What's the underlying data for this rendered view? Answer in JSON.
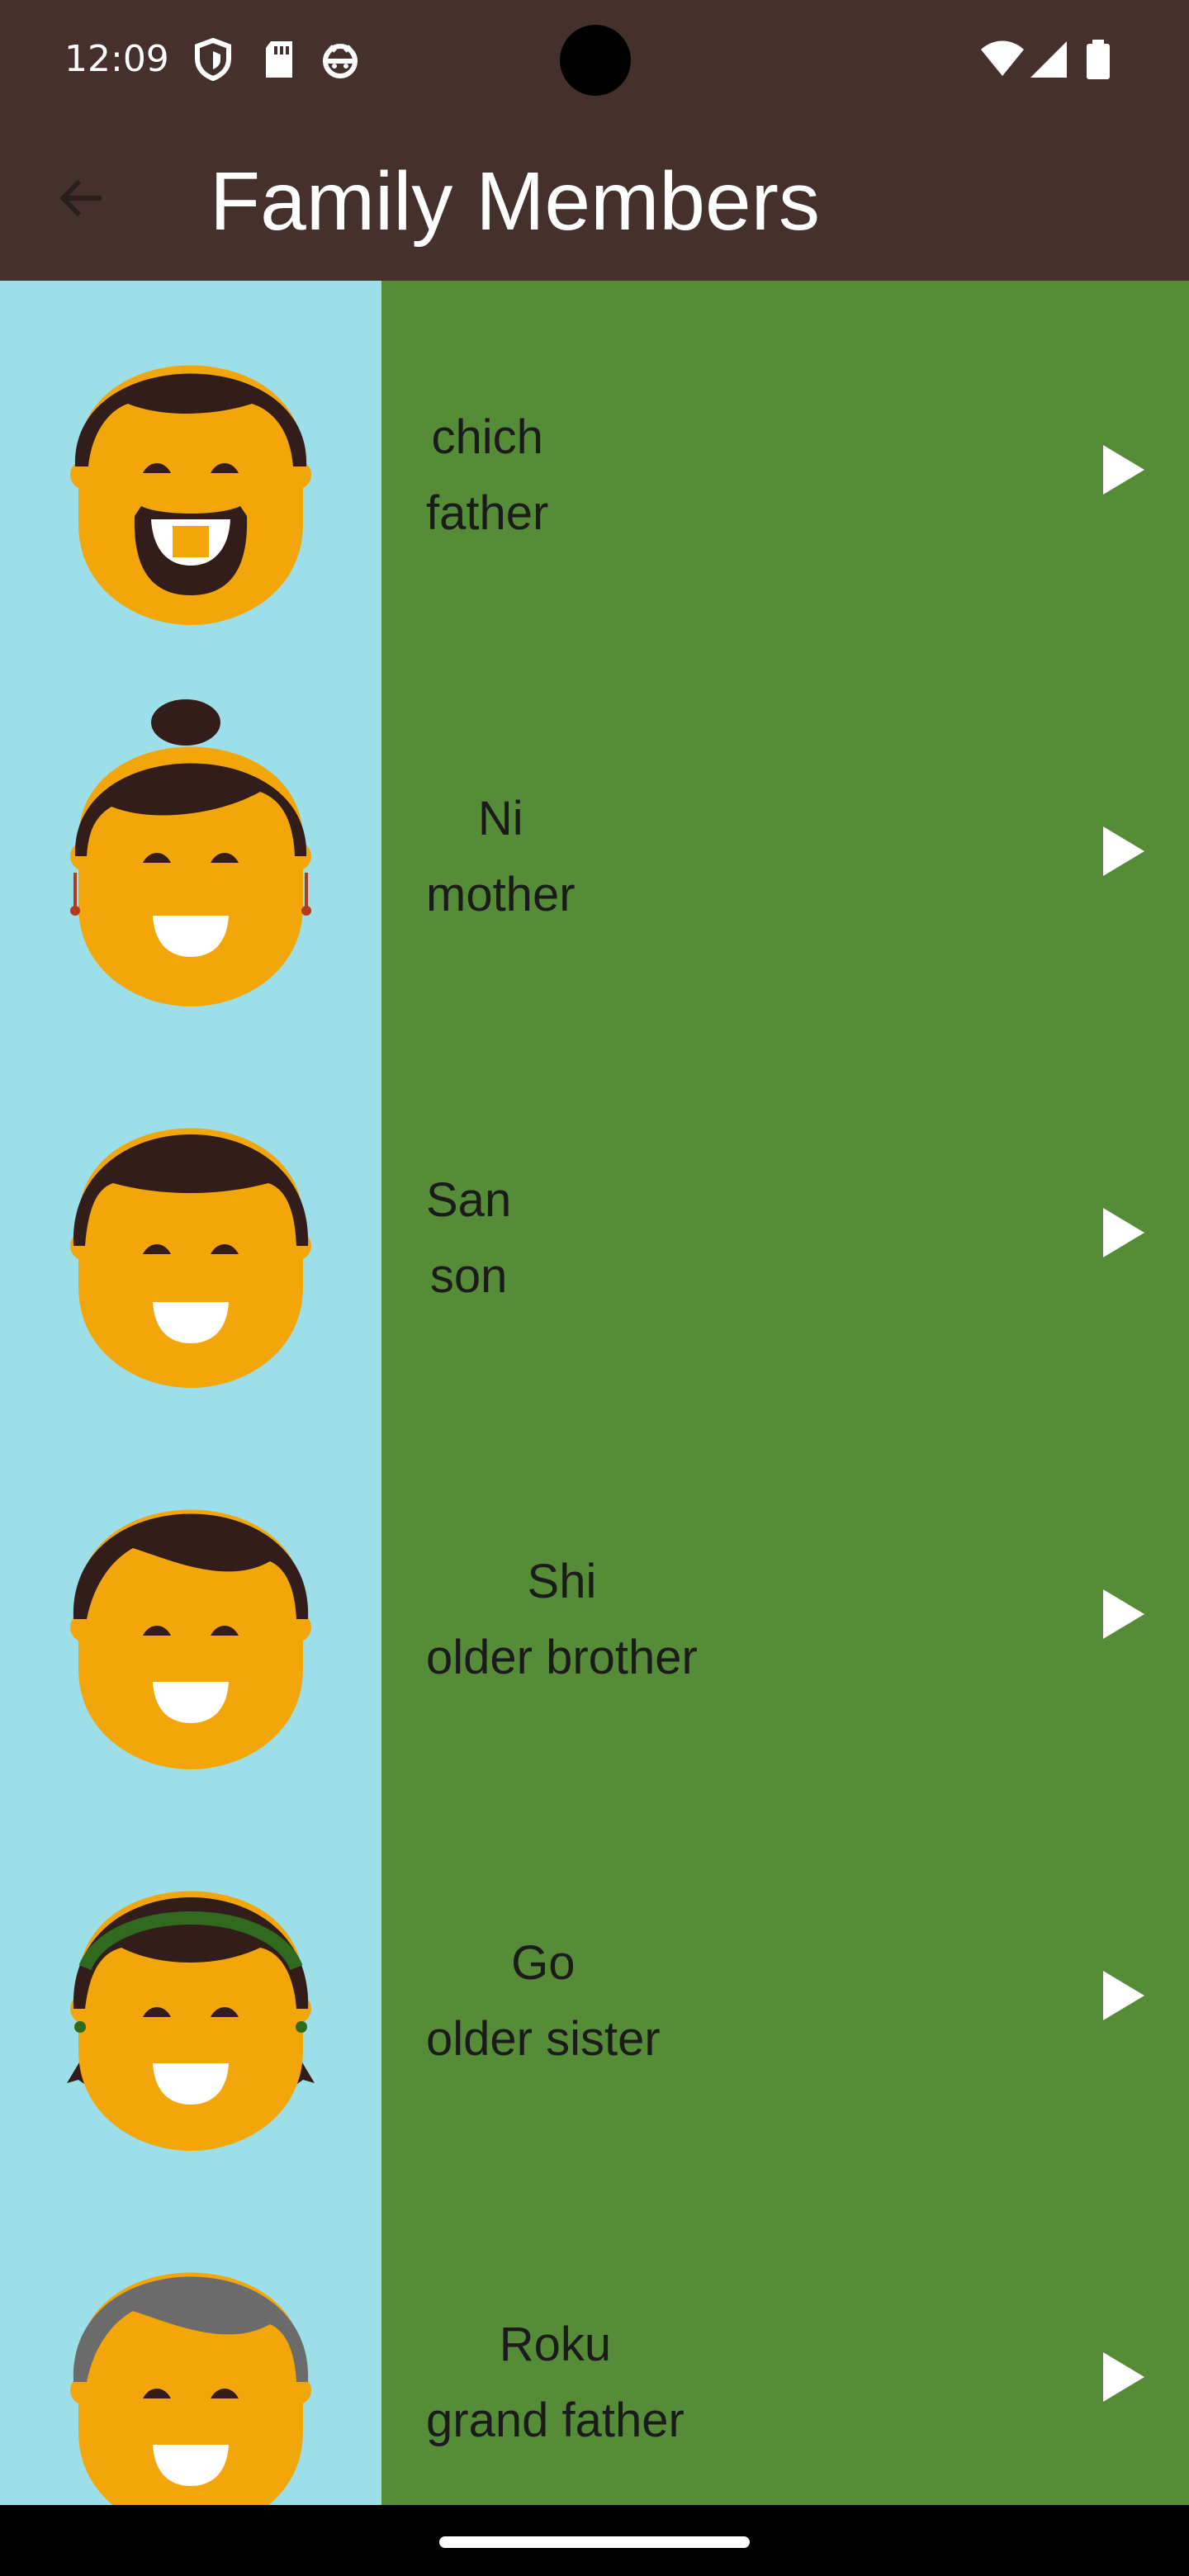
{
  "status_bar": {
    "time": "12:09",
    "left_icons": [
      "shield-icon",
      "sd-card-icon",
      "android-debug-icon"
    ],
    "right_icons": [
      "wifi-icon",
      "signal-icon",
      "battery-icon"
    ]
  },
  "app_bar": {
    "title": "Family Members",
    "back_icon": "arrow-back-icon"
  },
  "colors": {
    "app_bar": "#45302c",
    "image_background": "#9ddfe9",
    "item_background": "#568b38",
    "skin": "#f2a60a",
    "hair": "#321d1b",
    "grey_hair": "#6b6b6b",
    "headband": "#2f6a1e",
    "play_icon": "#ffffff",
    "text": "#1b1b1b"
  },
  "items": [
    {
      "word": "chich",
      "translation": "father",
      "avatar": "father-avatar-icon"
    },
    {
      "word": "Ni",
      "translation": "mother",
      "avatar": "mother-avatar-icon"
    },
    {
      "word": "San",
      "translation": "son",
      "avatar": "son-avatar-icon"
    },
    {
      "word": "Shi",
      "translation": "older brother",
      "avatar": "older-brother-avatar-icon"
    },
    {
      "word": "Go",
      "translation": "older sister",
      "avatar": "older-sister-avatar-icon"
    },
    {
      "word": "Roku",
      "translation": "grand father",
      "avatar": "grandfather-avatar-icon"
    }
  ]
}
